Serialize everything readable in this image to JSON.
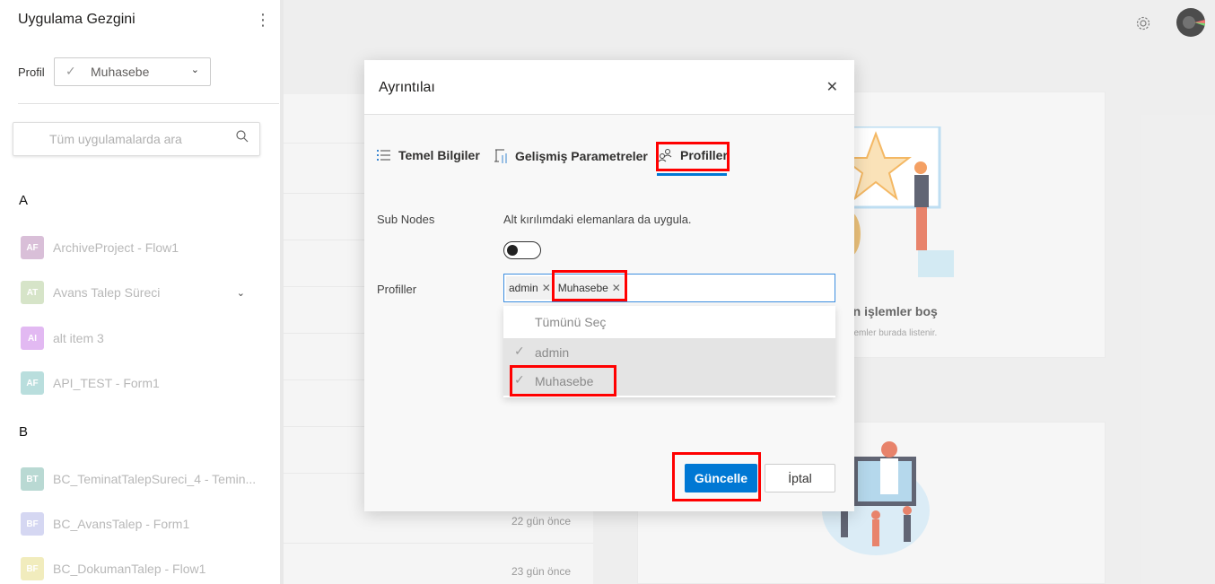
{
  "sidebar": {
    "title": "Uygulama Gezgini",
    "profile_label": "Profil",
    "profile_value": "Muhasebe",
    "search_placeholder": "Tüm uygulamalarda ara",
    "groups": [
      {
        "letter": "A",
        "items": [
          {
            "initials": "AF",
            "label": "ArchiveProject - Flow1",
            "color": "#d9bfd8"
          },
          {
            "initials": "AT",
            "label": "Avans Talep Süreci",
            "color": "#d6e4c8"
          },
          {
            "initials": "AI",
            "label": "alt item 3",
            "color": "#e2b9f2"
          },
          {
            "initials": "AF",
            "label": "API_TEST - Form1",
            "color": "#b9dedd"
          }
        ]
      },
      {
        "letter": "B",
        "items": [
          {
            "initials": "BT",
            "label": "BC_TeminatTalepSureci_4 - Temin...",
            "color": "#b9d9d3"
          },
          {
            "initials": "BF",
            "label": "BC_AvansTalep - Form1",
            "color": "#d5d7f2"
          },
          {
            "initials": "BF",
            "label": "BC_DokumanTalep - Flow1",
            "color": "#f1ecbd"
          }
        ]
      }
    ]
  },
  "background": {
    "times": [
      "22 gün önce",
      "23 gün önce"
    ],
    "card_title": "lan işlemler boş",
    "card_sub": "işlemler burada listenir."
  },
  "modal": {
    "title": "Ayrıntılaı",
    "tabs": [
      "Temel Bilgiler",
      "Gelişmiş Parametreler",
      "Profiller"
    ],
    "sub_nodes_label": "Sub Nodes",
    "sub_nodes_desc": "Alt kırılımdaki elemanlara da uygula.",
    "sub_nodes_on": false,
    "profiles_label": "Profiller",
    "selected_tags": [
      "admin",
      "Muhasebe"
    ],
    "dropdown": {
      "select_all": "Tümünü Seç",
      "options": [
        "admin",
        "Muhasebe"
      ]
    },
    "update_button": "Güncelle",
    "cancel_button": "İptal"
  },
  "colors": {
    "accent": "#0078d4",
    "highlight": "#ff0000"
  }
}
